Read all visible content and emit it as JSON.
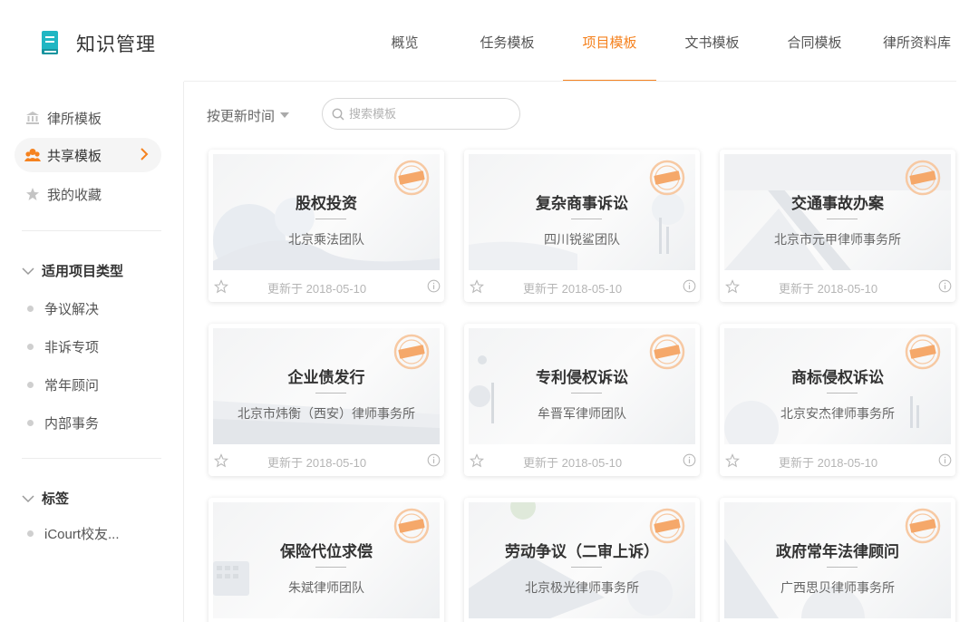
{
  "app": {
    "title": "知识管理"
  },
  "nav": {
    "items": [
      {
        "label": "概览",
        "active": false
      },
      {
        "label": "任务模板",
        "active": false
      },
      {
        "label": "项目模板",
        "active": true
      },
      {
        "label": "文书模板",
        "active": false
      },
      {
        "label": "合同模板",
        "active": false
      },
      {
        "label": "律所资料库",
        "active": false
      }
    ]
  },
  "sidebar": {
    "items": [
      {
        "label": "律所模板",
        "icon": "bank-icon",
        "active": false
      },
      {
        "label": "共享模板",
        "icon": "team-icon",
        "active": true
      },
      {
        "label": "我的收藏",
        "icon": "star-icon",
        "active": false
      }
    ],
    "project_types": {
      "title": "适用项目类型",
      "items": [
        "争议解决",
        "非诉专项",
        "常年顾问",
        "内部事务"
      ]
    },
    "tags": {
      "title": "标签",
      "items": [
        "iCourt校友..."
      ]
    }
  },
  "toolbar": {
    "sort_label": "按更新时间",
    "search_placeholder": "搜索模板"
  },
  "cards": [
    {
      "title": "股权投资",
      "team": "北京乘法团队",
      "date": "更新于 2018-05-10"
    },
    {
      "title": "复杂商事诉讼",
      "team": "四川锐鲨团队",
      "date": "更新于 2018-05-10"
    },
    {
      "title": "交通事故办案",
      "team": "北京市元甲律师事务所",
      "date": "更新于 2018-05-10"
    },
    {
      "title": "企业债发行",
      "team": "北京市炜衡（西安）律师事务所",
      "date": "更新于 2018-05-10"
    },
    {
      "title": "专利侵权诉讼",
      "team": "牟晋军律师团队",
      "date": "更新于 2018-05-10"
    },
    {
      "title": "商标侵权诉讼",
      "team": "北京安杰律师事务所",
      "date": "更新于 2018-05-10"
    },
    {
      "title": "保险代位求偿",
      "team": "朱斌律师团队",
      "date": "更新于 2018-05-10"
    },
    {
      "title": "劳动争议（二审上诉）",
      "team": "北京极光律师事务所",
      "date": "更新于 2018-05-10"
    },
    {
      "title": "政府常年法律顾问",
      "team": "广西思贝律师事务所",
      "date": "更新于 2018-05-10"
    }
  ],
  "colors": {
    "accent": "#f5821f",
    "logo": "#1fb6c3"
  }
}
